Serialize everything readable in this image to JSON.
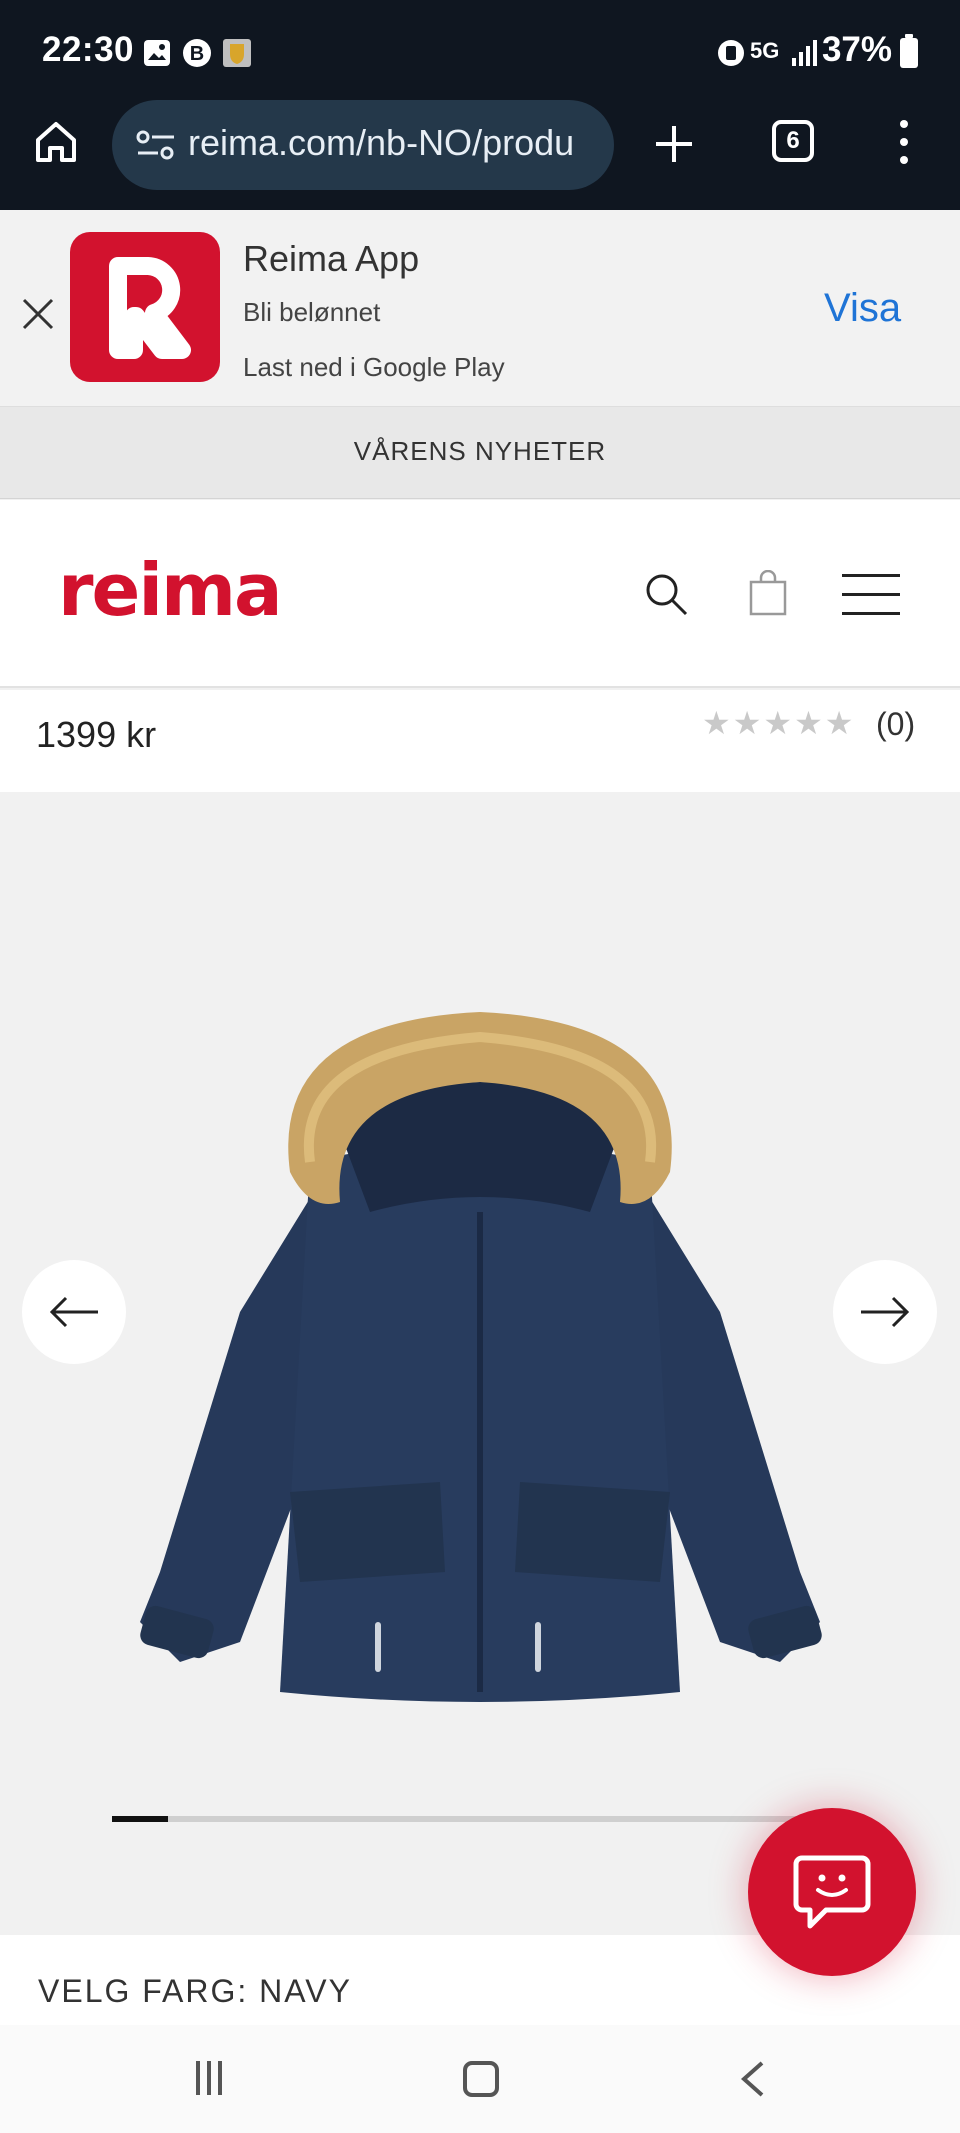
{
  "status_bar": {
    "time": "22:30",
    "battery": "37%",
    "network": "5G",
    "icons": [
      "image-icon",
      "b-app-icon",
      "app-icon",
      "vibrate-icon",
      "signal-icon",
      "battery-icon"
    ]
  },
  "browser": {
    "url": "reima.com/nb-NO/produ",
    "tab_count": "6"
  },
  "app_banner": {
    "title": "Reima App",
    "subtitle": "Bli belønnet",
    "store_text": "Last ned i Google Play",
    "action_label": "Visa",
    "accent": "#d2122e",
    "action_color": "#1f74d6"
  },
  "announcement": "VÅRENS NYHETER",
  "site_header": {
    "brand": "reima",
    "brand_color": "#d2122e"
  },
  "product": {
    "price": "1399 kr",
    "rating_stars": "★★★★★",
    "rating": 0,
    "review_count": "(0)",
    "color_label": "VELG FARG: NAVY",
    "gallery_progress": 0.08,
    "jacket_color": "#26395a",
    "fur_color": "#c9a465"
  }
}
